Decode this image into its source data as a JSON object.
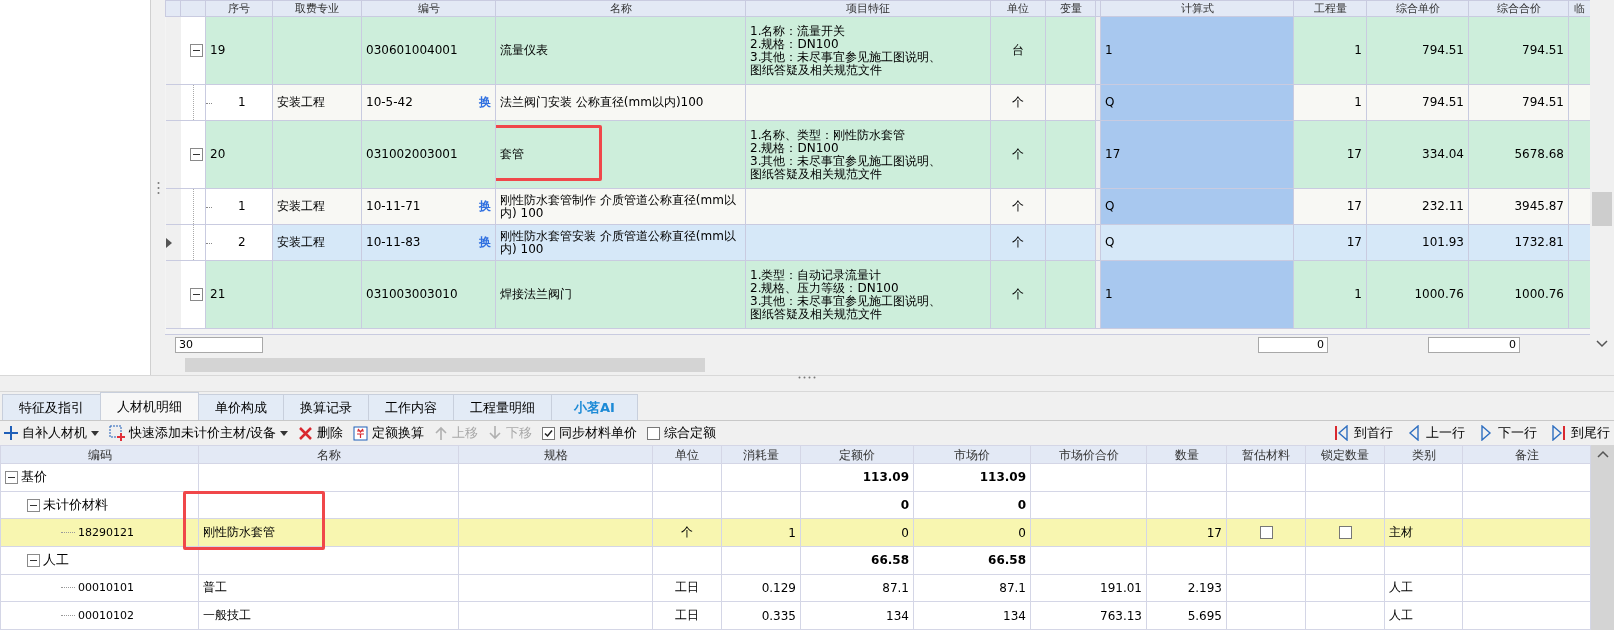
{
  "top_grid": {
    "columns": [
      "序号",
      "取费专业",
      "编号",
      "名称",
      "项目特征",
      "单位",
      "变量",
      "计算式",
      "工程量",
      "综合单价",
      "综合合价",
      "临"
    ],
    "rows": [
      {
        "seq": "19",
        "code": "030601004001",
        "name": "流量仪表",
        "features": [
          "1.名称：流量开关",
          "2.规格：DN100",
          "3.其他：未尽事宜参见施工图说明、",
          "图纸答疑及相关规范文件"
        ],
        "unit": "台",
        "formula": "1",
        "quantity": "1",
        "unit_price": "794.51",
        "total_price": "794.51",
        "expanded": true,
        "children": [
          {
            "seq": "1",
            "specialty": "安装工程",
            "code": "10-5-42",
            "swap": "换",
            "name": "法兰阀门安装 公称直径(mm以内)100",
            "unit": "个",
            "formula": "Q",
            "quantity": "1",
            "unit_price": "794.51",
            "total_price": "794.51",
            "selected": false
          }
        ]
      },
      {
        "seq": "20",
        "code": "031002003001",
        "name": "套管",
        "features": [
          "1.名称、类型：刚性防水套管",
          "2.规格：DN100",
          "3.其他：未尽事宜参见施工图说明、",
          "图纸答疑及相关规范文件"
        ],
        "unit": "个",
        "formula": "17",
        "quantity": "17",
        "unit_price": "334.04",
        "total_price": "5678.68",
        "expanded": true,
        "annotated": true,
        "children": [
          {
            "seq": "1",
            "specialty": "安装工程",
            "code": "10-11-71",
            "swap": "换",
            "name": "刚性防水套管制作 介质管道公称直径(mm以内) 100",
            "unit": "个",
            "formula": "Q",
            "quantity": "17",
            "unit_price": "232.11",
            "total_price": "3945.87",
            "selected": false
          },
          {
            "seq": "2",
            "specialty": "安装工程",
            "code": "10-11-83",
            "swap": "换",
            "name": "刚性防水套管安装 介质管道公称直径(mm以内) 100",
            "unit": "个",
            "formula": "Q",
            "quantity": "17",
            "unit_price": "101.93",
            "total_price": "1732.81",
            "selected": true
          }
        ]
      },
      {
        "seq": "21",
        "code": "031003003010",
        "name": "焊接法兰阀门",
        "features": [
          "1.类型：自动记录流量计",
          "2.规格、压力等级：DN100",
          "3.其他：未尽事宜参见施工图说明、",
          "图纸答疑及相关规范文件"
        ],
        "unit": "个",
        "formula": "1",
        "quantity": "1",
        "unit_price": "1000.76",
        "total_price": "1000.76",
        "expanded": true,
        "children": []
      }
    ],
    "footer": {
      "count": "30",
      "quantity_total": "0",
      "total_price_total": "0"
    }
  },
  "tabs": [
    {
      "label": "特征及指引",
      "selected": false,
      "kind": "normal"
    },
    {
      "label": "人材机明细",
      "selected": true,
      "kind": "normal"
    },
    {
      "label": "单价构成",
      "selected": false,
      "kind": "normal"
    },
    {
      "label": "换算记录",
      "selected": false,
      "kind": "normal"
    },
    {
      "label": "工作内容",
      "selected": false,
      "kind": "normal"
    },
    {
      "label": "工程量明细",
      "selected": false,
      "kind": "normal"
    },
    {
      "label": "小茗AI",
      "selected": false,
      "kind": "ai"
    }
  ],
  "toolbar": {
    "items": [
      {
        "kind": "add",
        "label": "自补人材机",
        "dropdown": true,
        "disabled": false
      },
      {
        "kind": "addmaterial",
        "label": "快速添加未计价主材/设备",
        "dropdown": true,
        "disabled": false
      },
      {
        "kind": "delete",
        "label": "删除",
        "disabled": false
      },
      {
        "kind": "convert",
        "label": "定额换算",
        "disabled": false
      },
      {
        "kind": "up",
        "label": "上移",
        "disabled": true
      },
      {
        "kind": "down",
        "label": "下移",
        "disabled": true
      },
      {
        "kind": "checkbox",
        "label": "同步材料单价",
        "checked": true
      },
      {
        "kind": "checkbox",
        "label": "综合定额",
        "checked": false
      }
    ],
    "navigation": [
      {
        "kind": "first",
        "label": "到首行"
      },
      {
        "kind": "prev",
        "label": "上一行"
      },
      {
        "kind": "next",
        "label": "下一行"
      },
      {
        "kind": "last",
        "label": "到尾行"
      }
    ]
  },
  "detail_grid": {
    "columns": [
      "编码",
      "名称",
      "规格",
      "单位",
      "消耗量",
      "定额价",
      "市场价",
      "市场价合价",
      "数量",
      "暂估材料",
      "锁定数量",
      "类别",
      "备注"
    ],
    "rows": [
      {
        "kind": "group",
        "code": "基价",
        "quota_price": "113.09",
        "market_price": "113.09",
        "expanded": true,
        "children": [
          {
            "kind": "group",
            "code": "未计价材料",
            "quota_price": "0",
            "market_price": "0",
            "expanded": true,
            "children": [
              {
                "kind": "item",
                "code": "18290121",
                "name": "刚性防水套管",
                "unit": "个",
                "consumption": "1",
                "quota_price": "0",
                "market_price": "0",
                "amount": "17",
                "provisional": false,
                "locked": false,
                "category": "主材",
                "selected": true,
                "annotated": true
              }
            ]
          },
          {
            "kind": "group",
            "code": "人工",
            "quota_price": "66.58",
            "market_price": "66.58",
            "expanded": true,
            "children": [
              {
                "kind": "item",
                "code": "00010101",
                "name": "普工",
                "unit": "工日",
                "consumption": "0.129",
                "quota_price": "87.1",
                "market_price": "87.1",
                "market_total": "191.01",
                "amount": "2.193",
                "category": "人工",
                "selected": false
              },
              {
                "kind": "item",
                "code": "00010102",
                "name": "一般技工",
                "unit": "工日",
                "consumption": "0.335",
                "quota_price": "134",
                "market_price": "134",
                "market_total": "763.13",
                "amount": "5.695",
                "category": "人工",
                "selected": false
              }
            ]
          }
        ]
      }
    ]
  }
}
